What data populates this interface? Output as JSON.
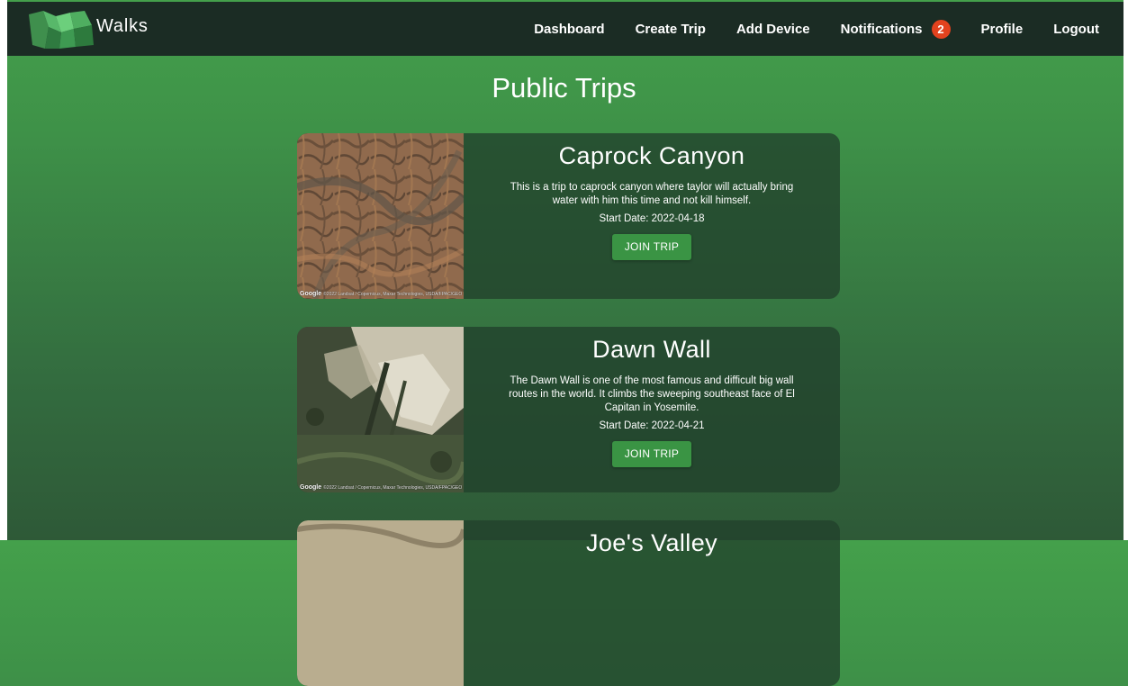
{
  "brand": {
    "name": "Walks"
  },
  "nav": {
    "dashboard": "Dashboard",
    "create_trip": "Create Trip",
    "add_device": "Add Device",
    "notifications": "Notifications",
    "notification_count": "2",
    "profile": "Profile",
    "logout": "Logout"
  },
  "page": {
    "title": "Public Trips"
  },
  "map_attribution": {
    "provider": "Google",
    "credit": "©2022 Landsat / Copernicus, Maxar Technologies, USDA/FPAC/GEO"
  },
  "trips": [
    {
      "name": "Caprock Canyon",
      "description": "This is a trip to caprock canyon where taylor will actually bring water with him this time and not kill himself.",
      "start_date": "Start Date: 2022-04-18",
      "button": "JOIN TRIP"
    },
    {
      "name": "Dawn Wall",
      "description": "The Dawn Wall is one of the most famous and difficult big wall routes in the world. It climbs the sweeping southeast face of El Capitan in Yosemite.",
      "start_date": "Start Date: 2022-04-21",
      "button": "JOIN TRIP"
    },
    {
      "name": "Joe's Valley",
      "description": "",
      "start_date": "",
      "button": ""
    }
  ],
  "colors": {
    "navbar": "#1b2c24",
    "badge": "#e3421e",
    "button": "#3a9444",
    "card": "#21402c"
  }
}
